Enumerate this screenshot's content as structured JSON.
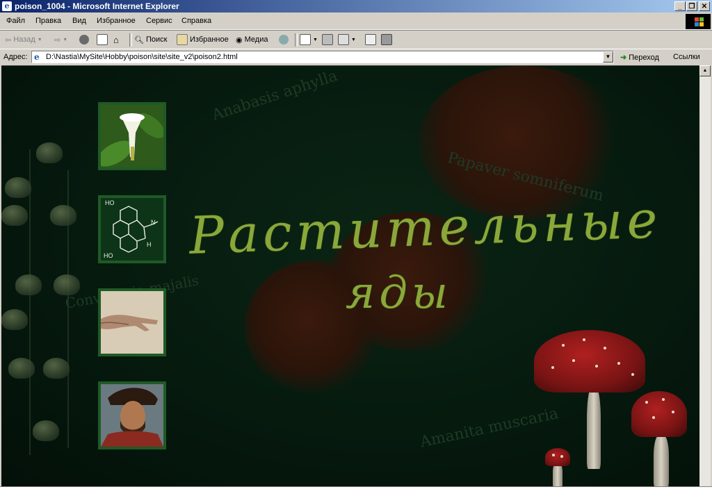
{
  "window": {
    "title": "poison_1004 - Microsoft Internet Explorer",
    "icon": "ie-icon",
    "controls": [
      "_",
      "❐",
      "✕"
    ]
  },
  "menu": {
    "items": [
      "Файл",
      "Правка",
      "Вид",
      "Избранное",
      "Сервис",
      "Справка"
    ]
  },
  "toolbar": {
    "back": "Назад",
    "search": "Поиск",
    "favorites": "Избранное",
    "media": "Медиа"
  },
  "address": {
    "label": "Адрес:",
    "url": "D:\\Nastia\\MySite\\Hobby\\poison\\site\\site_v2\\poison2.html",
    "go": "Переход",
    "links": "Ссылки"
  },
  "page": {
    "headline_line1": "Растительные",
    "headline_line2": "яды",
    "ghost_texts": {
      "anabasis": "Anabasis aphylla",
      "papaver": "Papaver somniferum",
      "convallaria": "Convallaria majalis",
      "amanita": "Amanita muscaria"
    },
    "thumbs": [
      {
        "name": "datura-flower-thumb"
      },
      {
        "name": "morphine-molecule-thumb",
        "labels": [
          "HO",
          "HO",
          "N",
          "H"
        ]
      },
      {
        "name": "hand-painting-thumb"
      },
      {
        "name": "portrait-thumb"
      }
    ]
  },
  "colors": {
    "background": "#061a0e",
    "headline": "#8aa83a",
    "thumb_border": "#1f5a26",
    "titlebar": "#0a246a"
  }
}
